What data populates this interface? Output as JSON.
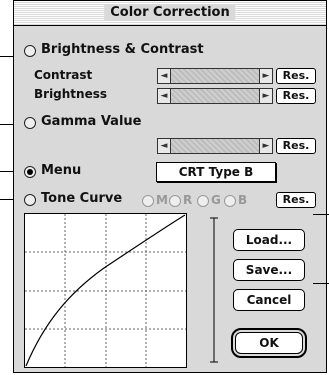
{
  "window": {
    "title": "Color Correction"
  },
  "sections": {
    "brightness_contrast": {
      "label": "Brightness & Contrast"
    },
    "gamma": {
      "label": "Gamma Value"
    },
    "menu": {
      "label": "Menu",
      "selected_value": "CRT Type B"
    },
    "tone_curve": {
      "label": "Tone Curve",
      "channels": [
        "M",
        "R",
        "G",
        "B"
      ]
    }
  },
  "rows": {
    "contrast": {
      "label": "Contrast",
      "reset_label": "Res."
    },
    "brightness": {
      "label": "Brightness",
      "reset_label": "Res."
    },
    "gamma": {
      "reset_label": "Res."
    },
    "tone": {
      "reset_label": "Res."
    }
  },
  "buttons": {
    "load": "Load...",
    "save": "Save...",
    "cancel": "Cancel",
    "ok": "OK"
  },
  "selection": {
    "mode": "Menu"
  },
  "icons": {
    "slider_left": "◄",
    "slider_right": "►"
  }
}
